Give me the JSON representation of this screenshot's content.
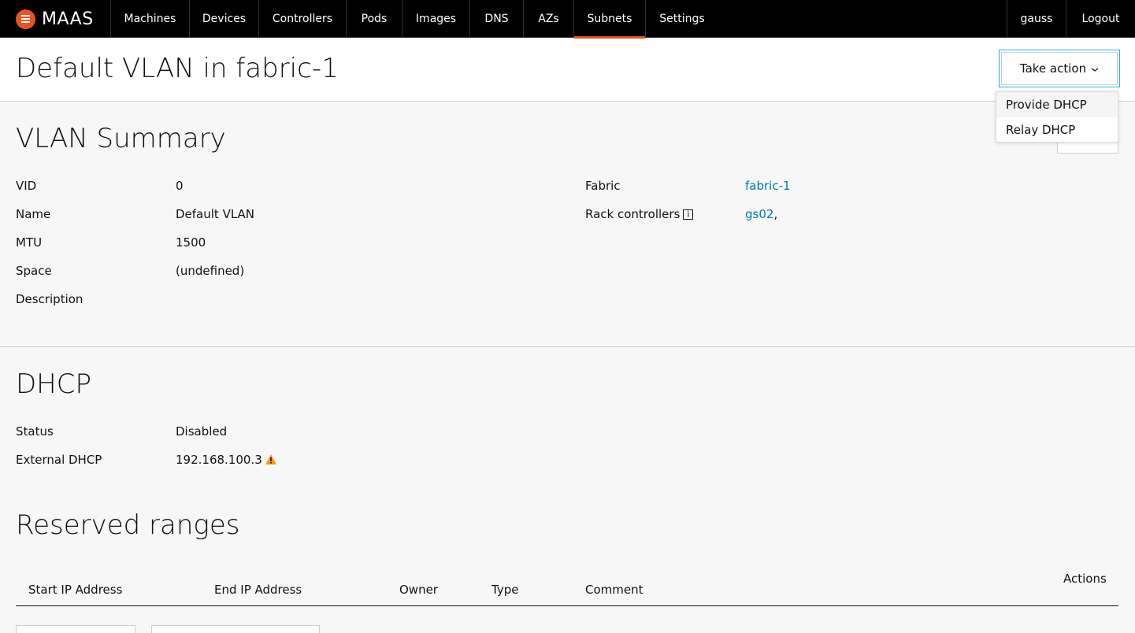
{
  "brand": {
    "name": "MAAS",
    "accent": "#e95420"
  },
  "nav": {
    "items": [
      {
        "label": "Machines",
        "name": "nav-machines"
      },
      {
        "label": "Devices",
        "name": "nav-devices"
      },
      {
        "label": "Controllers",
        "name": "nav-controllers"
      },
      {
        "label": "Pods",
        "name": "nav-pods"
      },
      {
        "label": "Images",
        "name": "nav-images"
      },
      {
        "label": "DNS",
        "name": "nav-dns"
      },
      {
        "label": "AZs",
        "name": "nav-azs"
      },
      {
        "label": "Subnets",
        "name": "nav-subnets",
        "active": true
      },
      {
        "label": "Settings",
        "name": "nav-settings"
      }
    ],
    "user": "gauss",
    "logout": "Logout"
  },
  "header": {
    "title": "Default VLAN in fabric-1",
    "take_action": "Take action"
  },
  "dropdown": {
    "items": [
      "Provide DHCP",
      "Relay DHCP"
    ]
  },
  "summary": {
    "title": "VLAN Summary",
    "fields": [
      {
        "label": "VID",
        "value": "0"
      },
      {
        "label": "Name",
        "value": "Default VLAN"
      },
      {
        "label": "MTU",
        "value": "1500"
      },
      {
        "label": "Space",
        "value": "(undefined)"
      },
      {
        "label": "Description",
        "value": ""
      }
    ],
    "fabric_label": "Fabric",
    "fabric_value": "fabric-1",
    "rack_label": "Rack controllers",
    "rack_value": "gs02",
    "rack_suffix": ","
  },
  "dhcp": {
    "title": "DHCP",
    "status_label": "Status",
    "status_value": "Disabled",
    "external_label": "External DHCP",
    "external_value": "192.168.100.3",
    "warning_color": "#f99b11"
  },
  "reserved": {
    "title": "Reserved ranges",
    "columns": [
      "Start IP Address",
      "End IP Address",
      "Owner",
      "Type",
      "Comment"
    ],
    "actions_label": "Actions"
  }
}
